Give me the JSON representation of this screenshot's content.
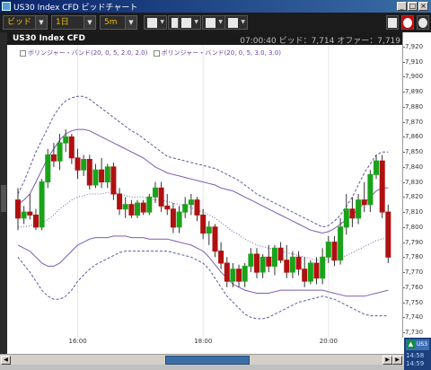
{
  "window": {
    "title": "US30 Index CFD ビッドチャート"
  },
  "toolbar": {
    "price_side": "ビッド",
    "period": "1日",
    "interval": "5m"
  },
  "chart_header": {
    "symbol": "US30 Index CFD",
    "time": "07:00:40",
    "bid_label": "ビッド：",
    "bid": "7,714",
    "offer_label": "オファー：",
    "offer": "7,719"
  },
  "legend": [
    "ボリンジャー・バンド(20, 0, 5, 2.0, 2.0)",
    "ボリンジャー・バンド(20, 0, 5, 3.0, 3.0)"
  ],
  "taskbar": {
    "app_label": "US3",
    "time1": "14:58",
    "time2": "14:59"
  },
  "colors": {
    "up": "#1aa31a",
    "down": "#b01010",
    "band_2sd": "#7b5bb0",
    "band_3sd": "#5a5aa0"
  },
  "chart_data": {
    "type": "candlestick",
    "ylim": [
      7730,
      7920
    ],
    "yticks": [
      "7,920",
      "7,910",
      "7,900",
      "7,890",
      "7,880",
      "7,870",
      "7,860",
      "7,850",
      "7,840",
      "7,830",
      "7,820",
      "7,810",
      "7,800",
      "7,790",
      "7,780",
      "7,770",
      "7,760",
      "7,750",
      "7,740",
      "7,730"
    ],
    "xticks": [
      "16:00",
      "18:00",
      "20:00"
    ],
    "candles": [
      {
        "o": 7818,
        "h": 7826,
        "l": 7798,
        "c": 7806
      },
      {
        "o": 7806,
        "h": 7814,
        "l": 7802,
        "c": 7810
      },
      {
        "o": 7810,
        "h": 7822,
        "l": 7805,
        "c": 7808
      },
      {
        "o": 7808,
        "h": 7812,
        "l": 7798,
        "c": 7800
      },
      {
        "o": 7800,
        "h": 7832,
        "l": 7798,
        "c": 7830
      },
      {
        "o": 7830,
        "h": 7852,
        "l": 7826,
        "c": 7848
      },
      {
        "o": 7848,
        "h": 7856,
        "l": 7840,
        "c": 7844
      },
      {
        "o": 7844,
        "h": 7862,
        "l": 7838,
        "c": 7856
      },
      {
        "o": 7856,
        "h": 7865,
        "l": 7850,
        "c": 7860
      },
      {
        "o": 7860,
        "h": 7862,
        "l": 7842,
        "c": 7846
      },
      {
        "o": 7846,
        "h": 7852,
        "l": 7832,
        "c": 7838
      },
      {
        "o": 7838,
        "h": 7848,
        "l": 7834,
        "c": 7845
      },
      {
        "o": 7845,
        "h": 7848,
        "l": 7825,
        "c": 7828
      },
      {
        "o": 7828,
        "h": 7842,
        "l": 7826,
        "c": 7838
      },
      {
        "o": 7838,
        "h": 7846,
        "l": 7826,
        "c": 7830
      },
      {
        "o": 7830,
        "h": 7842,
        "l": 7826,
        "c": 7840
      },
      {
        "o": 7840,
        "h": 7843,
        "l": 7818,
        "c": 7822
      },
      {
        "o": 7822,
        "h": 7826,
        "l": 7808,
        "c": 7812
      },
      {
        "o": 7812,
        "h": 7820,
        "l": 7806,
        "c": 7815
      },
      {
        "o": 7815,
        "h": 7818,
        "l": 7806,
        "c": 7808
      },
      {
        "o": 7808,
        "h": 7818,
        "l": 7806,
        "c": 7816
      },
      {
        "o": 7816,
        "h": 7818,
        "l": 7808,
        "c": 7810
      },
      {
        "o": 7810,
        "h": 7822,
        "l": 7808,
        "c": 7820
      },
      {
        "o": 7820,
        "h": 7830,
        "l": 7816,
        "c": 7826
      },
      {
        "o": 7826,
        "h": 7830,
        "l": 7810,
        "c": 7814
      },
      {
        "o": 7814,
        "h": 7822,
        "l": 7808,
        "c": 7812
      },
      {
        "o": 7812,
        "h": 7816,
        "l": 7796,
        "c": 7800
      },
      {
        "o": 7800,
        "h": 7814,
        "l": 7796,
        "c": 7810
      },
      {
        "o": 7810,
        "h": 7820,
        "l": 7806,
        "c": 7815
      },
      {
        "o": 7815,
        "h": 7822,
        "l": 7808,
        "c": 7818
      },
      {
        "o": 7818,
        "h": 7820,
        "l": 7804,
        "c": 7808
      },
      {
        "o": 7808,
        "h": 7812,
        "l": 7792,
        "c": 7796
      },
      {
        "o": 7796,
        "h": 7804,
        "l": 7788,
        "c": 7800
      },
      {
        "o": 7800,
        "h": 7802,
        "l": 7780,
        "c": 7784
      },
      {
        "o": 7784,
        "h": 7790,
        "l": 7772,
        "c": 7776
      },
      {
        "o": 7776,
        "h": 7780,
        "l": 7760,
        "c": 7764
      },
      {
        "o": 7764,
        "h": 7776,
        "l": 7760,
        "c": 7772
      },
      {
        "o": 7772,
        "h": 7775,
        "l": 7760,
        "c": 7764
      },
      {
        "o": 7764,
        "h": 7776,
        "l": 7760,
        "c": 7774
      },
      {
        "o": 7774,
        "h": 7786,
        "l": 7770,
        "c": 7782
      },
      {
        "o": 7782,
        "h": 7786,
        "l": 7766,
        "c": 7770
      },
      {
        "o": 7770,
        "h": 7782,
        "l": 7766,
        "c": 7780
      },
      {
        "o": 7780,
        "h": 7788,
        "l": 7770,
        "c": 7774
      },
      {
        "o": 7774,
        "h": 7788,
        "l": 7768,
        "c": 7786
      },
      {
        "o": 7786,
        "h": 7790,
        "l": 7776,
        "c": 7778
      },
      {
        "o": 7778,
        "h": 7788,
        "l": 7766,
        "c": 7770
      },
      {
        "o": 7770,
        "h": 7784,
        "l": 7766,
        "c": 7780
      },
      {
        "o": 7780,
        "h": 7784,
        "l": 7768,
        "c": 7772
      },
      {
        "o": 7772,
        "h": 7780,
        "l": 7760,
        "c": 7764
      },
      {
        "o": 7764,
        "h": 7778,
        "l": 7762,
        "c": 7776
      },
      {
        "o": 7776,
        "h": 7780,
        "l": 7762,
        "c": 7766
      },
      {
        "o": 7766,
        "h": 7786,
        "l": 7762,
        "c": 7780
      },
      {
        "o": 7780,
        "h": 7794,
        "l": 7776,
        "c": 7790
      },
      {
        "o": 7790,
        "h": 7794,
        "l": 7774,
        "c": 7778
      },
      {
        "o": 7778,
        "h": 7806,
        "l": 7775,
        "c": 7800
      },
      {
        "o": 7800,
        "h": 7822,
        "l": 7795,
        "c": 7812
      },
      {
        "o": 7812,
        "h": 7820,
        "l": 7800,
        "c": 7806
      },
      {
        "o": 7806,
        "h": 7822,
        "l": 7802,
        "c": 7818
      },
      {
        "o": 7818,
        "h": 7830,
        "l": 7810,
        "c": 7815
      },
      {
        "o": 7815,
        "h": 7838,
        "l": 7810,
        "c": 7835
      },
      {
        "o": 7835,
        "h": 7848,
        "l": 7832,
        "c": 7844
      },
      {
        "o": 7844,
        "h": 7848,
        "l": 7806,
        "c": 7810
      },
      {
        "o": 7810,
        "h": 7815,
        "l": 7776,
        "c": 7780
      }
    ],
    "bands": {
      "mid": [
        7800,
        7800,
        7801,
        7802,
        7803,
        7805,
        7808,
        7812,
        7815,
        7818,
        7820,
        7821,
        7822,
        7822,
        7822,
        7823,
        7823,
        7822,
        7821,
        7820,
        7820,
        7820,
        7819,
        7818,
        7818,
        7817,
        7816,
        7815,
        7814,
        7813,
        7811,
        7810,
        7808,
        7806,
        7803,
        7800,
        7797,
        7795,
        7792,
        7790,
        7788,
        7787,
        7786,
        7785,
        7784,
        7783,
        7782,
        7781,
        7780,
        7779,
        7778,
        7778,
        7778,
        7779,
        7780,
        7781,
        7783,
        7785,
        7787,
        7789,
        7791,
        7792,
        7793
      ],
      "u2": [
        7815,
        7818,
        7822,
        7830,
        7838,
        7846,
        7852,
        7858,
        7862,
        7864,
        7865,
        7865,
        7864,
        7862,
        7860,
        7858,
        7856,
        7854,
        7852,
        7850,
        7848,
        7846,
        7843,
        7840,
        7838,
        7836,
        7835,
        7834,
        7833,
        7832,
        7831,
        7830,
        7829,
        7828,
        7826,
        7825,
        7824,
        7822,
        7820,
        7818,
        7816,
        7814,
        7812,
        7810,
        7808,
        7806,
        7804,
        7802,
        7800,
        7798,
        7797,
        7796,
        7797,
        7799,
        7802,
        7805,
        7808,
        7812,
        7816,
        7820,
        7824,
        7826,
        7826
      ],
      "l2": [
        7788,
        7786,
        7784,
        7780,
        7776,
        7774,
        7774,
        7776,
        7780,
        7784,
        7788,
        7790,
        7792,
        7793,
        7793,
        7793,
        7794,
        7794,
        7794,
        7793,
        7793,
        7793,
        7792,
        7792,
        7792,
        7792,
        7791,
        7790,
        7789,
        7788,
        7786,
        7784,
        7780,
        7775,
        7770,
        7766,
        7762,
        7760,
        7758,
        7757,
        7756,
        7756,
        7756,
        7757,
        7758,
        7758,
        7758,
        7758,
        7758,
        7758,
        7758,
        7758,
        7757,
        7756,
        7755,
        7754,
        7754,
        7754,
        7754,
        7755,
        7756,
        7757,
        7758
      ],
      "u3": [
        7822,
        7830,
        7840,
        7850,
        7858,
        7866,
        7874,
        7880,
        7884,
        7886,
        7887,
        7887,
        7885,
        7882,
        7879,
        7876,
        7873,
        7870,
        7867,
        7864,
        7862,
        7859,
        7856,
        7853,
        7850,
        7847,
        7846,
        7845,
        7844,
        7843,
        7842,
        7841,
        7840,
        7839,
        7837,
        7835,
        7833,
        7831,
        7828,
        7825,
        7822,
        7820,
        7818,
        7816,
        7814,
        7812,
        7810,
        7808,
        7806,
        7804,
        7802,
        7800,
        7801,
        7804,
        7808,
        7814,
        7820,
        7828,
        7836,
        7842,
        7848,
        7850,
        7850
      ],
      "l3": [
        7780,
        7775,
        7770,
        7764,
        7758,
        7754,
        7752,
        7752,
        7754,
        7758,
        7764,
        7768,
        7772,
        7775,
        7777,
        7779,
        7781,
        7783,
        7784,
        7784,
        7784,
        7784,
        7784,
        7784,
        7784,
        7784,
        7783,
        7782,
        7781,
        7780,
        7778,
        7776,
        7772,
        7766,
        7760,
        7754,
        7750,
        7746,
        7742,
        7740,
        7739,
        7739,
        7740,
        7742,
        7744,
        7746,
        7748,
        7750,
        7751,
        7752,
        7753,
        7754,
        7753,
        7752,
        7750,
        7748,
        7746,
        7744,
        7742,
        7741,
        7741,
        7741,
        7741
      ]
    }
  }
}
